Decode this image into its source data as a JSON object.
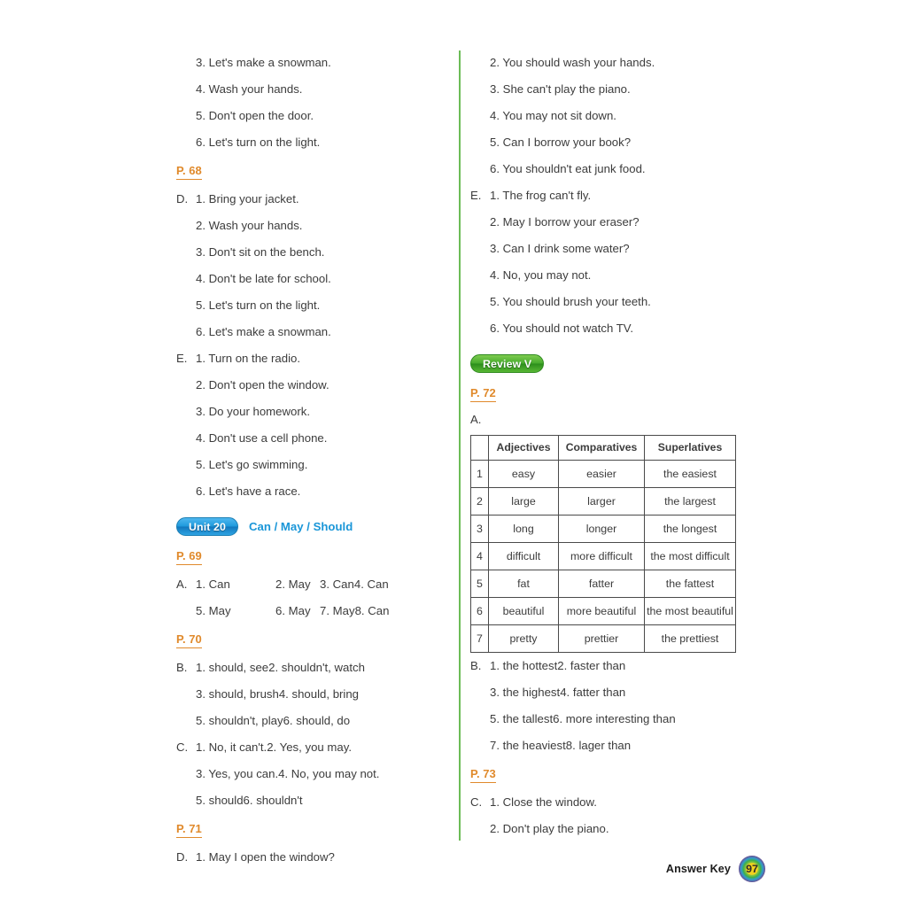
{
  "document": {
    "footer_label": "Answer Key",
    "page_number": "97",
    "accent_orange": "#e08a2c",
    "accent_blue": "#1a96d8",
    "accent_green": "#6cbc57"
  },
  "left_column": {
    "top_lines": [
      "3. Let's make a snowman.",
      "4. Wash your hands.",
      "5. Don't open the door.",
      "6. Let's turn on the light."
    ],
    "p68": {
      "ref": "P. 68",
      "section_d": {
        "letter": "D.",
        "items": [
          "1. Bring your jacket.",
          "2. Wash your hands.",
          "3. Don't sit on the bench.",
          "4. Don't be late for school.",
          "5. Let's turn on the light.",
          "6. Let's make a snowman."
        ]
      },
      "section_e": {
        "letter": "E.",
        "items": [
          "1. Turn on the radio.",
          "2. Don't open the window.",
          "3. Do your homework.",
          "4. Don't use a cell phone.",
          "5. Let's go swimming.",
          "6. Let's have a race."
        ]
      }
    },
    "unit_badge": {
      "label": "Unit 20",
      "title": "Can / May / Should"
    },
    "p69": {
      "ref": "P. 69",
      "section_a": {
        "letter": "A.",
        "rows": [
          [
            "1. Can",
            "2. May",
            "3. Can",
            "4. Can"
          ],
          [
            "5. May",
            "6. May",
            "7. May",
            "8. Can"
          ]
        ]
      }
    },
    "p70": {
      "ref": "P. 70",
      "section_b": {
        "letter": "B.",
        "rows": [
          [
            "1. should, see",
            "2. shouldn't, watch"
          ],
          [
            "3. should, brush",
            "4. should, bring"
          ],
          [
            "5. shouldn't, play",
            "6. should, do"
          ]
        ]
      },
      "section_c": {
        "letter": "C.",
        "rows": [
          [
            "1. No, it can't.",
            "2. Yes, you may."
          ],
          [
            "3. Yes, you can.",
            "4. No, you may not."
          ],
          [
            "5. should",
            "6. shouldn't"
          ]
        ]
      }
    },
    "p71": {
      "ref": "P. 71",
      "section_d": {
        "letter": "D.",
        "items": [
          "1. May I open the window?"
        ]
      }
    }
  },
  "right_column": {
    "top_lines": [
      "2. You should wash your hands.",
      "3. She can't play the piano.",
      "4. You may not sit down.",
      "5. Can I borrow your book?",
      "6. You shouldn't eat junk food."
    ],
    "section_e": {
      "letter": "E.",
      "items": [
        "1. The frog can't fly.",
        "2. May I borrow your eraser?",
        "3. Can I drink some water?",
        "4. No, you may not.",
        "5. You should brush your teeth.",
        "6. You should not watch TV."
      ]
    },
    "review_badge": {
      "label": "Review V"
    },
    "p72": {
      "ref": "P. 72",
      "section_a_label": "A.",
      "table": {
        "headers": [
          "",
          "Adjectives",
          "Comparatives",
          "Superlatives"
        ],
        "rows": [
          [
            "1",
            "easy",
            "easier",
            "the easiest"
          ],
          [
            "2",
            "large",
            "larger",
            "the largest"
          ],
          [
            "3",
            "long",
            "longer",
            "the longest"
          ],
          [
            "4",
            "difficult",
            "more difficult",
            "the most difficult"
          ],
          [
            "5",
            "fat",
            "fatter",
            "the fattest"
          ],
          [
            "6",
            "beautiful",
            "more beautiful",
            "the most beautiful"
          ],
          [
            "7",
            "pretty",
            "prettier",
            "the prettiest"
          ]
        ]
      },
      "section_b": {
        "letter": "B.",
        "rows": [
          [
            "1. the hottest",
            "2. faster than"
          ],
          [
            "3. the highest",
            "4. fatter than"
          ],
          [
            "5. the tallest",
            "6. more interesting than"
          ],
          [
            "7. the heaviest",
            "8. lager than"
          ]
        ]
      }
    },
    "p73": {
      "ref": "P. 73",
      "section_c": {
        "letter": "C.",
        "items": [
          "1. Close the window.",
          "2. Don't play the piano."
        ]
      }
    }
  }
}
